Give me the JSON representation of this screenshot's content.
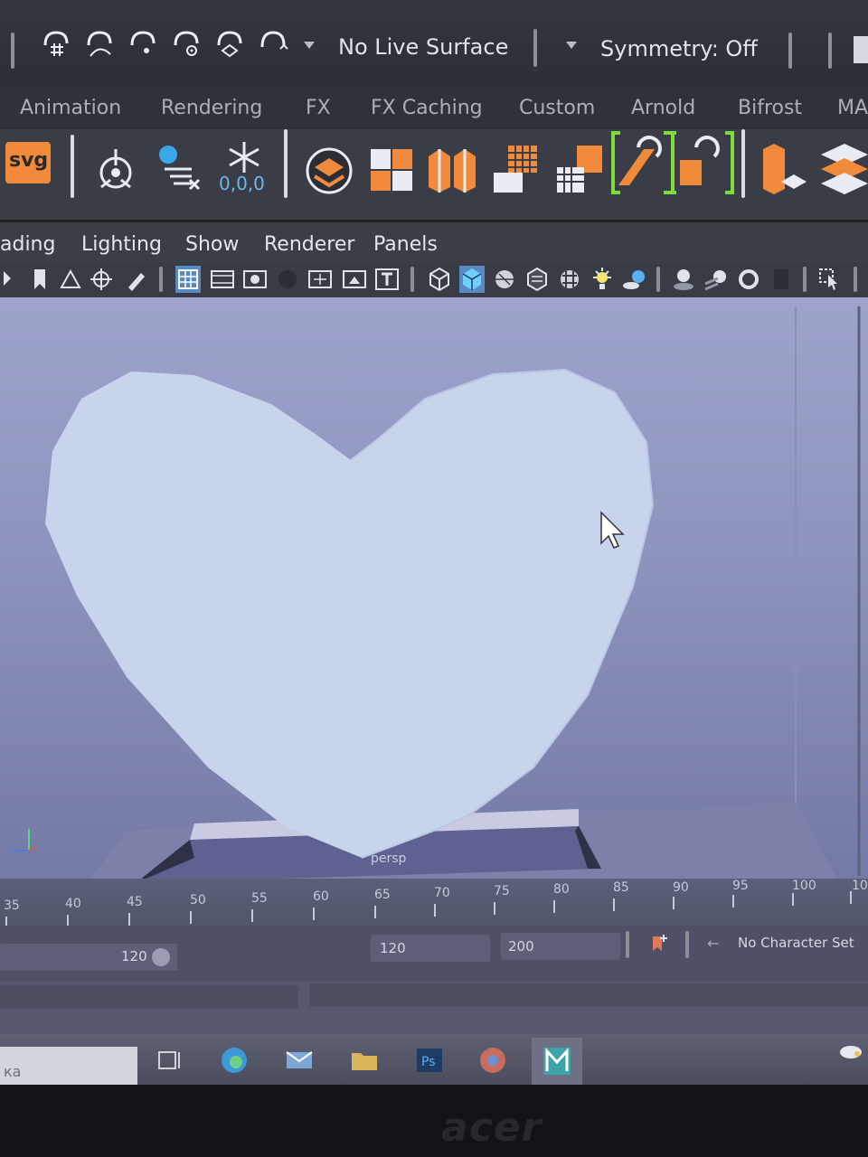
{
  "status_line": {
    "snap_icons": [
      "snap-grid-icon",
      "snap-curve-icon",
      "snap-point-icon",
      "snap-view-plane-icon",
      "snap-surface-icon",
      "magnet-icon"
    ],
    "live_surface": "No Live Surface",
    "symmetry": "Symmetry: Off"
  },
  "shelf_tabs": [
    "Animation",
    "Rendering",
    "FX",
    "FX Caching",
    "Custom",
    "Arnold",
    "Bifrost",
    "MA"
  ],
  "shelf": {
    "icons": [
      "svg-icon",
      "joint-tool-icon",
      "bake-icon",
      "freeze-transforms-icon",
      "layers-icon",
      "quad-blocks-icon",
      "split-cubes-icon",
      "grid-blocks-icon",
      "grid-blocks-2-icon",
      "rotate-brackets-icon",
      "cube-stack-icon",
      "stacked-tiles-icon"
    ],
    "svg_label": "svg",
    "freeze_label": "0,0,0"
  },
  "panel_menu": [
    "ading",
    "Lighting",
    "Show",
    "Renderer",
    "Panels"
  ],
  "viewport": {
    "camera": "persp",
    "accent": "#f07a2a"
  },
  "time_slider": {
    "ticks": [
      "35",
      "40",
      "45",
      "50",
      "55",
      "60",
      "65",
      "70",
      "75",
      "80",
      "85",
      "90",
      "95",
      "100",
      "10"
    ]
  },
  "range_slider": {
    "playback_end": "120",
    "anim_end": "120",
    "anim_total": "200",
    "character_set": "No Character Set"
  },
  "taskbar": {
    "search_text": "ка"
  },
  "monitor": {
    "brand": "acer"
  }
}
